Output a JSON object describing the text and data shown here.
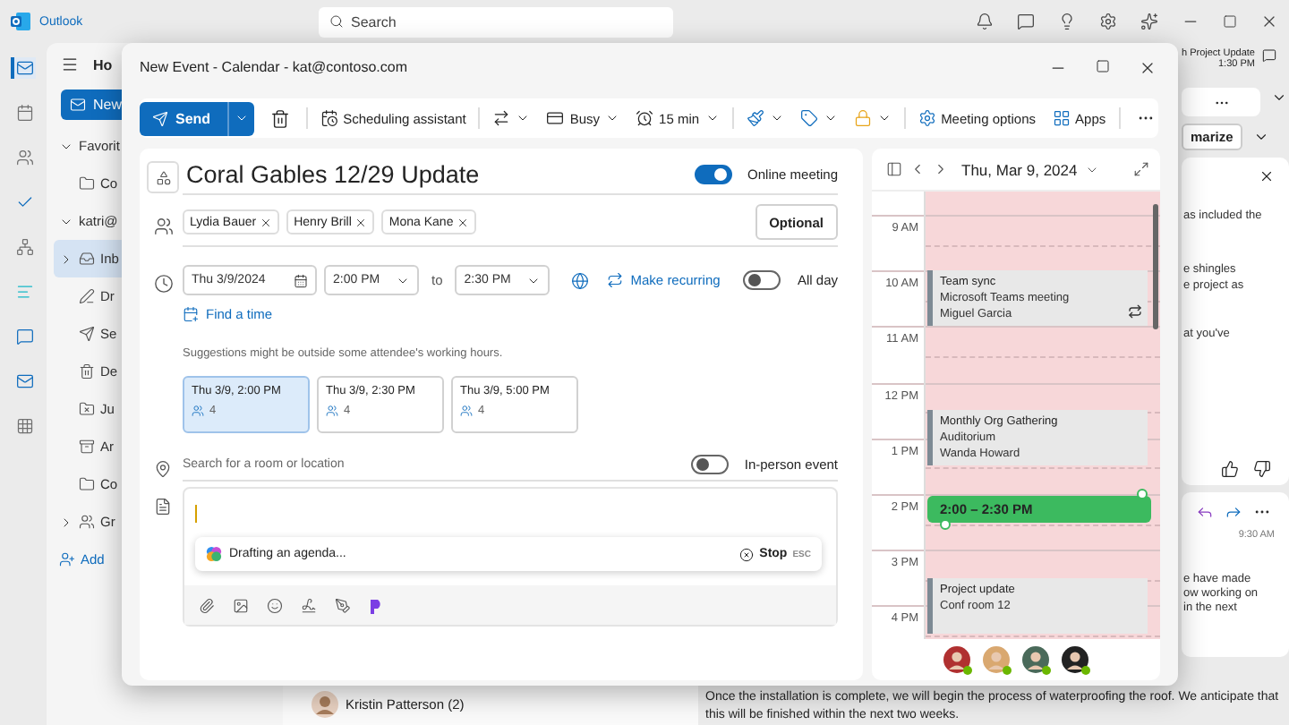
{
  "app": {
    "name": "Outlook",
    "search_placeholder": "Search"
  },
  "rail": [
    {
      "kind": "mail",
      "selected": true
    },
    {
      "kind": "calendar",
      "selected": false
    },
    {
      "kind": "people",
      "selected": false
    },
    {
      "kind": "todo",
      "selected": false
    },
    {
      "kind": "org",
      "selected": false
    },
    {
      "kind": "app",
      "selected": false
    },
    {
      "kind": "teams",
      "selected": false
    },
    {
      "kind": "outlook",
      "selected": false
    },
    {
      "kind": "more",
      "selected": false
    }
  ],
  "folder_pane": {
    "tab": "Ho",
    "new_button": "New",
    "items": [
      {
        "kind": "section",
        "label": "Favorit",
        "expanded": true,
        "selected": false
      },
      {
        "kind": "folder",
        "label": "Co",
        "selected": false
      },
      {
        "kind": "section",
        "label": "katri@",
        "expanded": true,
        "selected": false
      },
      {
        "kind": "inbox",
        "label": "Inb",
        "expanded": false,
        "selected": true
      },
      {
        "kind": "drafts",
        "label": "Dr",
        "selected": false
      },
      {
        "kind": "sent",
        "label": "Se",
        "selected": false
      },
      {
        "kind": "deleted",
        "label": "De",
        "selected": false
      },
      {
        "kind": "junk",
        "label": "Ju",
        "selected": false
      },
      {
        "kind": "archive",
        "label": "Ar",
        "selected": false
      },
      {
        "kind": "folder",
        "label": "Co",
        "selected": false
      },
      {
        "kind": "groups",
        "label": "Gr",
        "expanded": false,
        "selected": false
      },
      {
        "kind": "add",
        "label": "Add",
        "selected": false
      }
    ]
  },
  "message_list": {
    "sender": "Kristin Patterson (2)"
  },
  "reading_pane": {
    "header_title": "h Project Update",
    "header_time": "1:30 PM",
    "summarize": "marize",
    "card_lines": [
      "as included the",
      "e shingles",
      "e project as",
      "at you've"
    ],
    "reply_time": "9:30 AM",
    "reply_lines": [
      "e have made",
      "ow working on",
      "in the next"
    ],
    "body_lines": [
      "Once the installation is complete, we will begin the process of waterproofing the roof. We anticipate that",
      "this will be finished within the next two weeks."
    ]
  },
  "dialog": {
    "title": "New Event - Calendar - kat@contoso.com",
    "toolbar": {
      "send": "Send",
      "scheduling": "Scheduling assistant",
      "show_as": "Busy",
      "reminder": "15 min",
      "meeting_options": "Meeting options",
      "apps": "Apps"
    },
    "form": {
      "subject": "Coral Gables 12/29 Update",
      "online_meeting": {
        "label": "Online meeting",
        "on": true
      },
      "attendees": [
        "Lydia Bauer",
        "Henry Brill",
        "Mona Kane"
      ],
      "optional_button": "Optional",
      "date": "Thu 3/9/2024",
      "start_time": "2:00 PM",
      "to": "to",
      "end_time": "2:30 PM",
      "recurring": "Make recurring",
      "all_day": {
        "label": "All day",
        "on": false
      },
      "find_time": "Find a time",
      "suggestion_note": "Suggestions might be outside some attendee's working hours.",
      "suggestions": [
        {
          "time": "Thu 3/9, 2:00 PM",
          "count": "4",
          "selected": true
        },
        {
          "time": "Thu 3/9, 2:30 PM",
          "count": "4",
          "selected": false
        },
        {
          "time": "Thu 3/9, 5:00 PM",
          "count": "4",
          "selected": false
        }
      ],
      "location_placeholder": "Search for a room or location",
      "in_person": {
        "label": "In-person event",
        "on": false
      },
      "copilot": {
        "text": "Drafting an agenda...",
        "stop": "Stop",
        "shortcut": "ESC"
      }
    },
    "calendar": {
      "date": "Thu, Mar 9, 2024",
      "hours": [
        "9 AM",
        "10 AM",
        "11 AM",
        "12 PM",
        "1 PM",
        "2 PM",
        "3 PM",
        "4 PM"
      ],
      "events": [
        {
          "kind": "meeting",
          "title": "Team sync",
          "lines": [
            "Microsoft Teams meeting",
            "Miguel Garcia"
          ],
          "recurring": true
        },
        {
          "kind": "meeting",
          "title": "Monthly Org Gathering",
          "lines": [
            "Auditorium",
            "Wanda Howard"
          ],
          "recurring": false
        },
        {
          "kind": "new",
          "title": "2:00 – 2:30 PM"
        },
        {
          "kind": "meeting",
          "title": "Project update",
          "lines": [
            "Conf room 12"
          ],
          "recurring": false
        }
      ],
      "attendees": [
        {
          "color": "#6bb700"
        },
        {
          "color": "#6bb700"
        },
        {
          "color": "#6bb700"
        },
        {
          "color": "#6bb700"
        }
      ]
    }
  }
}
